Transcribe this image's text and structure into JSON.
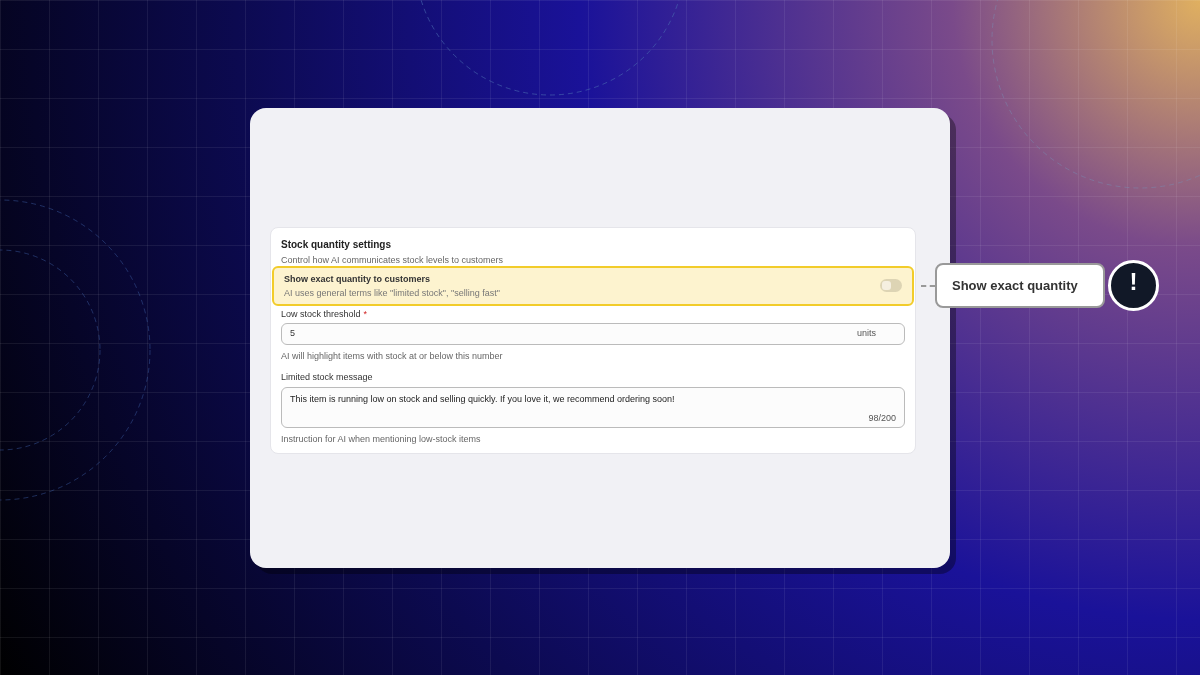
{
  "settings": {
    "title": "Stock quantity settings",
    "subtitle": "Control how AI communicates stock levels to customers",
    "toggle_row": {
      "label": "Show exact quantity to customers",
      "description": "AI uses general terms like \"limited stock\", \"selling fast\"",
      "on": false,
      "highlighted": true
    },
    "threshold": {
      "label": "Low stock threshold",
      "required_mark": "*",
      "value": "5",
      "suffix": "units",
      "help": "AI will highlight items with stock at or below this number"
    },
    "message": {
      "label": "Limited stock message",
      "value": "This item is running low on stock and selling quickly. If you love it, we recommend ordering soon!",
      "counter": "98/200",
      "help": "Instruction for AI when mentioning low-stock items"
    }
  },
  "callout": {
    "label": "Show exact quantity",
    "badge": "!"
  }
}
